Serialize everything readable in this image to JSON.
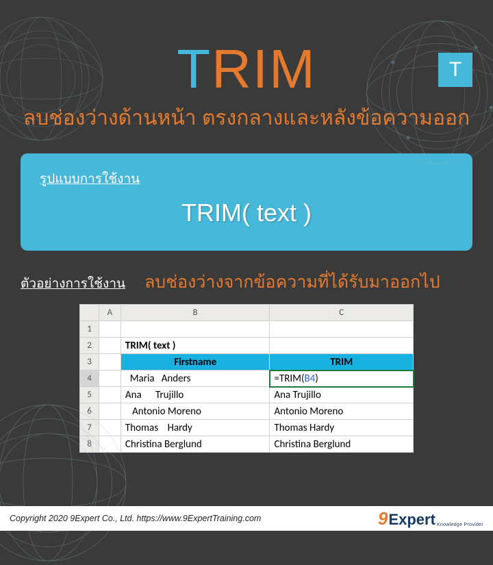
{
  "badge": "T",
  "title": {
    "first": "T",
    "rest": "RIM"
  },
  "subtitle": "ลบช่องว่างด้านหน้า ตรงกลางและหลังข้อความออก",
  "syntax": {
    "label": "รูปแบบการใช้งาน",
    "body": "TRIM( text )"
  },
  "example": {
    "label": "ตัวอย่างการใช้งาน",
    "desc": "ลบช่องว่างจากข้อความที่ได้รับมาออกไป"
  },
  "sheet": {
    "col_headers": [
      "A",
      "B",
      "C"
    ],
    "row_headers": [
      "1",
      "2",
      "3",
      "4",
      "5",
      "6",
      "7",
      "8"
    ],
    "title_cell": "TRIM( text )",
    "table_head": [
      "Firstname",
      "TRIM"
    ],
    "formula": {
      "fn": "=TRIM(",
      "ref": "B4",
      "close": ")"
    },
    "rows": [
      {
        "b": "  Maria   Anders",
        "c_formula": true
      },
      {
        "b": "Ana      Trujillo",
        "c": "Ana Trujillo"
      },
      {
        "b": "   Antonio Moreno",
        "c": "Antonio Moreno"
      },
      {
        "b": "Thomas    Hardy",
        "c": "Thomas Hardy"
      },
      {
        "b": "Christina Berglund",
        "c": "Christina Berglund"
      }
    ]
  },
  "footer": {
    "copyright": "Copyright 2020 9Expert Co., Ltd.   https://www.9ExpertTraining.com",
    "logo_nine": "9",
    "logo_expert": "Expert",
    "logo_sub": "Knowledge Provider"
  }
}
